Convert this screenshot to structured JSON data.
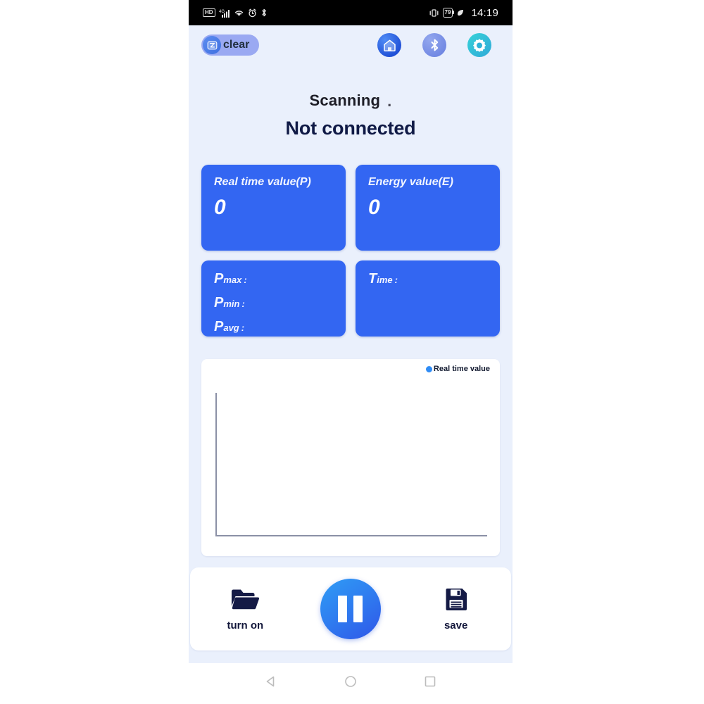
{
  "status_bar": {
    "hd_label": "HD",
    "icons_left": [
      "hd-icon",
      "signal-bars-icon",
      "wifi-icon",
      "alarm-clock-icon",
      "bluetooth-icon"
    ],
    "icons_right": [
      "vibrate-icon",
      "battery-icon",
      "charging-leaf-icon"
    ],
    "battery_level": "79",
    "clock": "14:19"
  },
  "toolbar": {
    "clear_label": "clear",
    "clear_icon": "clear-badge-icon",
    "home_icon": "home-icon",
    "bluetooth_icon": "bluetooth-icon",
    "settings_icon": "gear-icon"
  },
  "status": {
    "scanning_text": "Scanning",
    "scanning_dots": ".",
    "connection_state": "Not connected"
  },
  "cards": [
    {
      "title": "Real time value(P)",
      "value": "0"
    },
    {
      "title": "Energy value(E)",
      "value": "0"
    }
  ],
  "stats_card": {
    "rows": [
      {
        "prefix": "P",
        "sub": "max",
        "colon": ":",
        "value": ""
      },
      {
        "prefix": "P",
        "sub": "min",
        "colon": ":",
        "value": ""
      },
      {
        "prefix": "P",
        "sub": "avg",
        "colon": ":",
        "value": ""
      }
    ]
  },
  "time_card": {
    "prefix": "T",
    "sub": "ime",
    "colon": ":",
    "value": ""
  },
  "chart_data": {
    "type": "line",
    "title": "",
    "xlabel": "",
    "ylabel": "",
    "legend": [
      "Real time value"
    ],
    "legend_position": "top-right",
    "legend_color": "#2f8cf5",
    "series": [
      {
        "name": "Real time value",
        "x": [],
        "values": []
      }
    ],
    "grid": false,
    "axes_visible": true,
    "xlim": [
      0,
      0
    ],
    "ylim": [
      0,
      0
    ],
    "xticks": [],
    "yticks": [],
    "note": "Empty plot: only x and y axis lines are drawn, no data points."
  },
  "controls": {
    "turn_on_label": "turn on",
    "turn_on_icon": "folder-icon",
    "pause_icon": "pause-icon",
    "save_label": "save",
    "save_icon": "floppy-disk-icon"
  },
  "navbar": {
    "back_icon": "back-triangle-icon",
    "home_icon": "home-circle-icon",
    "recents_icon": "recents-square-icon"
  },
  "colors": {
    "background": "#eaf0fc",
    "card_blue": "#3366f2",
    "accent_blue": "#2f8cf5",
    "text_dark": "#101a46"
  }
}
